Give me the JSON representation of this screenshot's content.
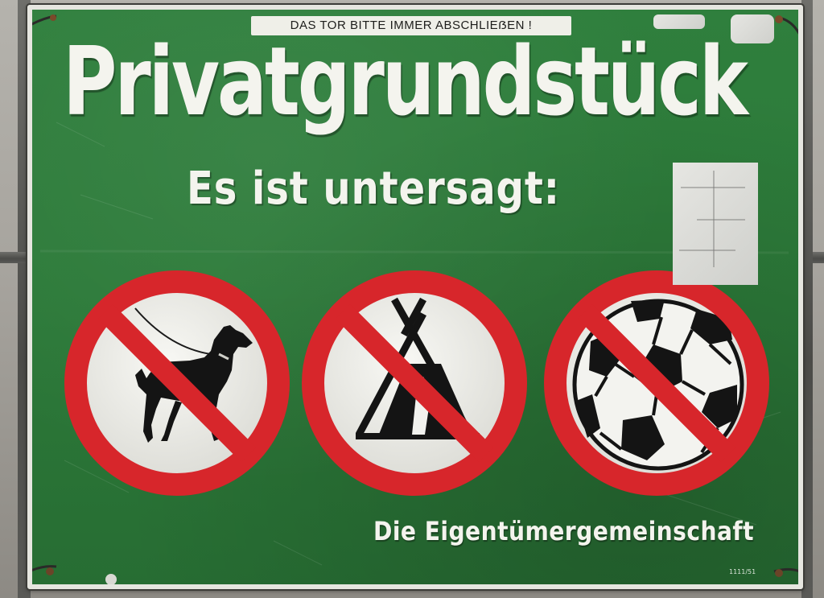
{
  "sign": {
    "notice": "DAS TOR BITTE IMMER ABSCHLIEẞEN !",
    "headline": "Privatgrundstück",
    "subheadline": "Es ist untersagt:",
    "footer": "Die Eigentümergemeinschaft",
    "serial": "1111/51"
  },
  "prohibitions": [
    {
      "icon": "dog-on-leash-icon"
    },
    {
      "icon": "tent-icon"
    },
    {
      "icon": "soccer-ball-icon"
    }
  ],
  "colors": {
    "sign_green": "#2c7a39",
    "sign_text": "#f4f4ee",
    "prohibition_red": "#d7262b",
    "symbol_black": "#141414"
  }
}
